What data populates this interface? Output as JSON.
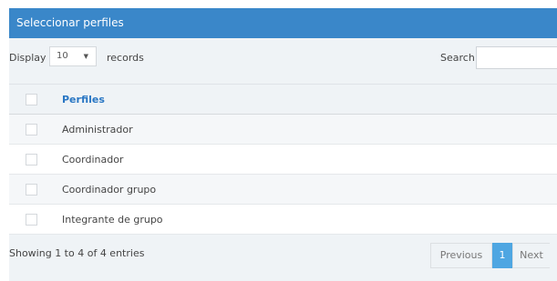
{
  "panel": {
    "title": "Seleccionar perfiles"
  },
  "controls": {
    "display_label": "Display",
    "length_value": "10",
    "records_label": "records",
    "search_label": "Search:",
    "search_value": ""
  },
  "table": {
    "header": "Perfiles",
    "rows": [
      {
        "label": "Administrador",
        "checked": false
      },
      {
        "label": "Coordinador",
        "checked": false
      },
      {
        "label": "Coordinador grupo",
        "checked": false
      },
      {
        "label": "Integrante de grupo",
        "checked": false
      }
    ]
  },
  "footer": {
    "info": "Showing 1 to 4 of 4 entries",
    "previous_label": "Previous",
    "current_page": "1",
    "next_label": "Next"
  },
  "colors": {
    "header_bg": "#3a87c9",
    "link_blue": "#2a77c4",
    "active_page": "#4ea6e2"
  }
}
